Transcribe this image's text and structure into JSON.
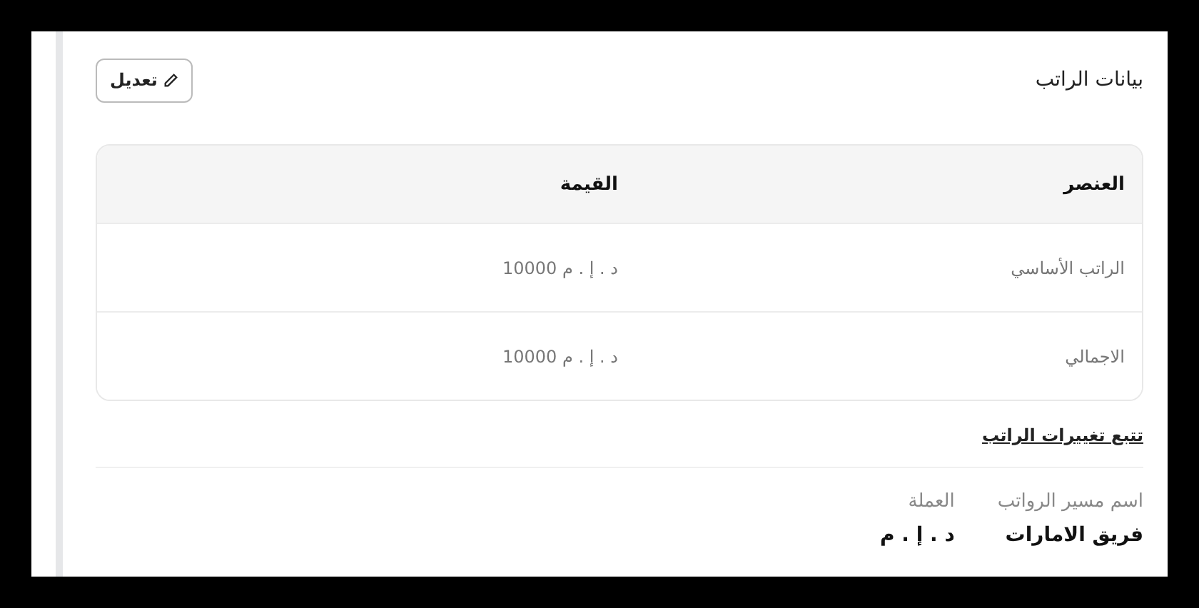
{
  "section": {
    "title": "بيانات الراتب",
    "edit_button": "تعديل"
  },
  "table": {
    "columns": [
      "العنصر",
      "القيمة"
    ],
    "rows": [
      [
        "الراتب الأساسي",
        "د . إ . م 10000"
      ],
      [
        "الاجمالي",
        "د . إ . م 10000"
      ]
    ]
  },
  "link": "تتبع تغييرات الراتب",
  "fields": [
    {
      "label": "اسم مسير الرواتب",
      "value": "فريق الامارات"
    },
    {
      "label": "العملة",
      "value": "د . إ . م"
    }
  ]
}
